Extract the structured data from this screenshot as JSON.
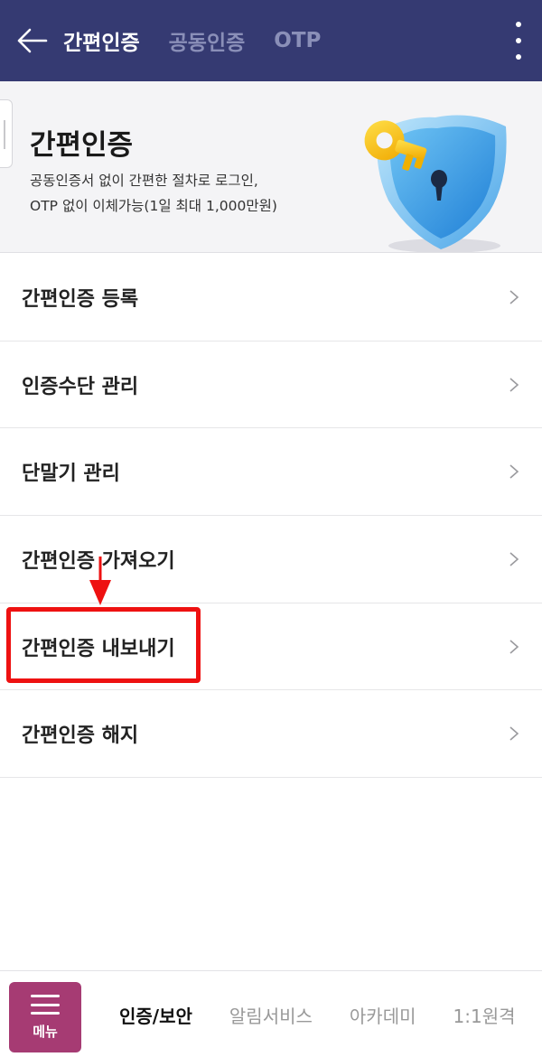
{
  "header": {
    "tabs": [
      {
        "label": "간편인증",
        "active": true
      },
      {
        "label": "공동인증",
        "active": false
      },
      {
        "label": "OTP",
        "active": false
      }
    ],
    "back_icon": "arrow-left-icon",
    "more_icon": "more-vertical-icon"
  },
  "banner": {
    "title": "간편인증",
    "desc_line1": "공동인증서 없이 간편한 절차로 로그인,",
    "desc_line2": "OTP 없이 이체가능(1일 최대 1,000만원)",
    "art_icon": "key-shield-icon"
  },
  "menu": {
    "items": [
      {
        "label": "간편인증 등록"
      },
      {
        "label": "인증수단 관리"
      },
      {
        "label": "단말기 관리"
      },
      {
        "label": "간편인증 가져오기"
      },
      {
        "label": "간편인증 내보내기"
      },
      {
        "label": "간편인증 해지"
      }
    ],
    "highlighted_item": "간편인증 내보내기"
  },
  "bottom_nav": {
    "menu_label": "메뉴",
    "tabs": [
      {
        "label": "인증/보안",
        "active": true
      },
      {
        "label": "알림서비스",
        "active": false
      },
      {
        "label": "아카데미",
        "active": false
      },
      {
        "label": "1:1원격",
        "active": false
      }
    ]
  },
  "colors": {
    "header_bg": "#353a72",
    "menu_button_bg": "#a63b73",
    "highlight": "#ee1111",
    "banner_bg": "#f4f4f6"
  }
}
